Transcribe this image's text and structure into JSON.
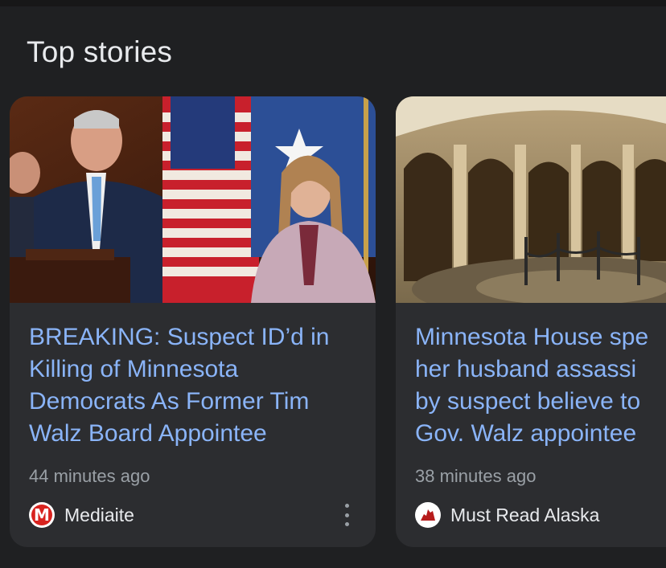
{
  "section": {
    "title": "Top stories"
  },
  "stories": [
    {
      "headline": "BREAKING: Suspect ID’d in\nKilling of Minnesota\nDemocrats As Former Tim\nWalz Board Appointee",
      "time": "44 minutes ago",
      "source": "Mediaite",
      "favicon_letter": "M",
      "favicon_color": "#d8231f"
    },
    {
      "headline": "Minnesota House spe\nher husband assassi\nby suspect believe to\nGov. Walz appointee",
      "time": "38 minutes ago",
      "source": "Must Read Alaska",
      "favicon_color": "#b71c1c"
    }
  ],
  "colors": {
    "background": "#1f2022",
    "card": "#2c2d30",
    "headline": "#8ab4f8",
    "meta": "#9aa0a6"
  }
}
